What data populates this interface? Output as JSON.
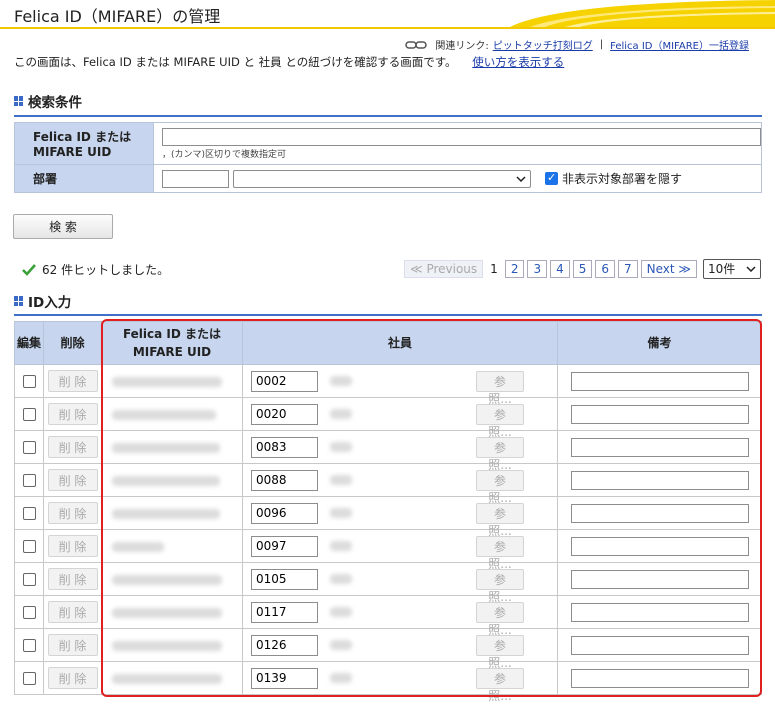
{
  "header": {
    "title": "Felica ID（MIFARE）の管理"
  },
  "related": {
    "label": "関連リンク:",
    "link1": "ピットタッチ打刻ログ",
    "separator": "|",
    "link2": "Felica ID（MIFARE）一括登録"
  },
  "description": {
    "text": "この画面は、Felica ID または MIFARE UID と 社員 との紐づけを確認する画面です。",
    "help_link": "使い方を表示する"
  },
  "search": {
    "section_title": "検索条件",
    "id_label_line1": "Felica ID または",
    "id_label_line2": "MIFARE UID",
    "id_value": "",
    "id_hint": "，(カンマ)区切りで複数指定可",
    "dept_label": "部署",
    "dept_code_value": "",
    "dept_select_value": "",
    "hide_label": "非表示対象部署を隠す",
    "hide_checked": true,
    "button_label": "検 索"
  },
  "result": {
    "check_icon": "check-icon",
    "hit_text": "62 件ヒットしました。"
  },
  "pager": {
    "previous": "≪ Previous",
    "pages": [
      "1",
      "2",
      "3",
      "4",
      "5",
      "6",
      "7"
    ],
    "current": "1",
    "next": "Next ≫",
    "per_page": "10件"
  },
  "id_section": {
    "title": "ID入力",
    "col_edit": "編集",
    "col_delete": "削除",
    "col_id_line1": "Felica ID または",
    "col_id_line2": "MIFARE UID",
    "col_employee": "社員",
    "col_note": "備考"
  },
  "rows": [
    {
      "delete_label": "削 除",
      "employee_code": "0002",
      "ref_label": "参照...",
      "note": ""
    },
    {
      "delete_label": "削 除",
      "employee_code": "0020",
      "ref_label": "参照...",
      "note": ""
    },
    {
      "delete_label": "削 除",
      "employee_code": "0083",
      "ref_label": "参照...",
      "note": ""
    },
    {
      "delete_label": "削 除",
      "employee_code": "0088",
      "ref_label": "参照...",
      "note": ""
    },
    {
      "delete_label": "削 除",
      "employee_code": "0096",
      "ref_label": "参照...",
      "note": ""
    },
    {
      "delete_label": "削 除",
      "employee_code": "0097",
      "ref_label": "参照...",
      "note": ""
    },
    {
      "delete_label": "削 除",
      "employee_code": "0105",
      "ref_label": "参照...",
      "note": ""
    },
    {
      "delete_label": "削 除",
      "employee_code": "0117",
      "ref_label": "参照...",
      "note": ""
    },
    {
      "delete_label": "削 除",
      "employee_code": "0126",
      "ref_label": "参照...",
      "note": ""
    },
    {
      "delete_label": "削 除",
      "employee_code": "0139",
      "ref_label": "参照...",
      "note": ""
    }
  ],
  "colors": {
    "accent_blue": "#3f6fc8",
    "header_yellow": "#f2c800",
    "highlight_red": "#e02020",
    "header_cell": "#c7d6ee"
  }
}
